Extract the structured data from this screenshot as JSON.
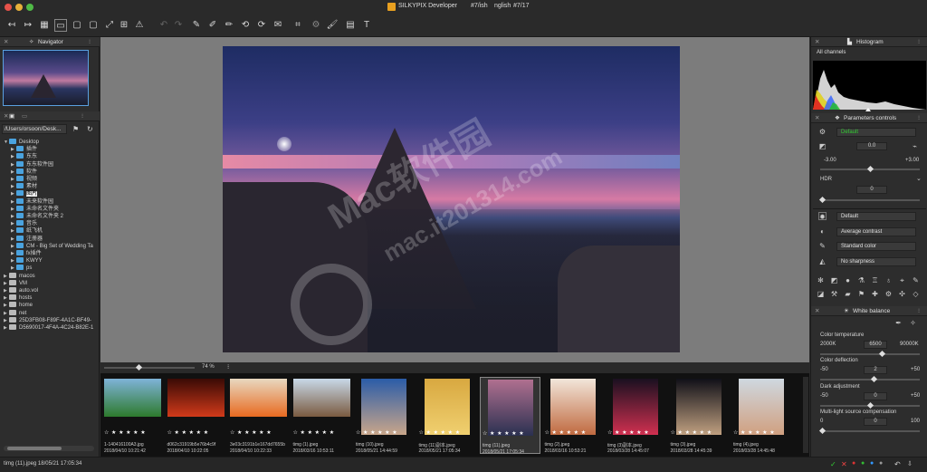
{
  "window": {
    "title": "SILKYPIX Developer",
    "subtitle_1": "#7/ish",
    "subtitle_2": "nglish",
    "subtitle_3": "#7/17"
  },
  "navigator": {
    "title": "Navigator"
  },
  "folders": {
    "path": "/Users/orsoon/Desk...",
    "items": [
      {
        "label": "Desktop",
        "level": 0,
        "expanded": true
      },
      {
        "label": "插件",
        "level": 1
      },
      {
        "label": "东东",
        "level": 1
      },
      {
        "label": "东东软件园",
        "level": 1
      },
      {
        "label": "软件",
        "level": 1
      },
      {
        "label": "视频",
        "level": 1
      },
      {
        "label": "素材",
        "level": 1
      },
      {
        "label": "图片",
        "level": 1,
        "selected": true
      },
      {
        "label": "未来软件园",
        "level": 1
      },
      {
        "label": "未命名文件夹",
        "level": 1
      },
      {
        "label": "未命名文件夹 2",
        "level": 1
      },
      {
        "label": "音乐",
        "level": 1
      },
      {
        "label": "纸飞机",
        "level": 1
      },
      {
        "label": "注册器",
        "level": 1
      },
      {
        "label": "CM - Big Set of Wedding Ta",
        "level": 1
      },
      {
        "label": "fx插件",
        "level": 1
      },
      {
        "label": "KWYY",
        "level": 1
      },
      {
        "label": "ps",
        "level": 1
      },
      {
        "label": "macos",
        "level": 0
      },
      {
        "label": "VM",
        "level": 0
      },
      {
        "label": "auto.vol",
        "level": 0
      },
      {
        "label": "hosts",
        "level": 0
      },
      {
        "label": "home",
        "level": 0
      },
      {
        "label": "net",
        "level": 0
      },
      {
        "label": "25D3FB08-F89F-4A1C-BF49-",
        "level": 0
      },
      {
        "label": "D5690017-4F4A-4C24-B82E-1",
        "level": 0
      }
    ]
  },
  "viewer": {
    "zoom": "74 %"
  },
  "filmstrip": [
    {
      "file": "1-140416100A3.jpg",
      "date": "2018/04/10 10:21:42",
      "colors": [
        "#7fb3d8",
        "#2d7a2d"
      ]
    },
    {
      "file": "d062c31919b5e76b4c9f",
      "date": "2018/04/10 10:22:05",
      "colors": [
        "#3a0a05",
        "#d13a1a"
      ]
    },
    {
      "file": "3e03c3191b1e167dd7655b",
      "date": "2018/04/10 10:22:33",
      "colors": [
        "#e8d8c0",
        "#e86a20"
      ]
    },
    {
      "file": "timg (1).jpeg",
      "date": "2018/03/16 10:53:11",
      "colors": [
        "#c8d8e8",
        "#7a5a40"
      ]
    },
    {
      "file": "timg (10).jpeg",
      "date": "2018/05/21 14:44:59",
      "colors": [
        "#2b5ca8",
        "#c9a68a"
      ]
    },
    {
      "file": "timg (11)副本.jpeg",
      "date": "2018/05/21 17:05:34",
      "colors": [
        "#d8a840",
        "#f0d070"
      ]
    },
    {
      "file": "timg (11).jpeg",
      "date": "2018/05/21 17:05:34",
      "colors": [
        "#b07090",
        "#2a3050"
      ]
    },
    {
      "file": "timg (2).jpeg",
      "date": "2018/03/16 10:53:21",
      "colors": [
        "#f2e6da",
        "#c06a40"
      ]
    },
    {
      "file": "timg (3)副本.jpeg",
      "date": "2018/03/28 14:45:07",
      "colors": [
        "#1a1020",
        "#d03050"
      ]
    },
    {
      "file": "timg (3).jpeg",
      "date": "2018/03/28 14:45:39",
      "colors": [
        "#101018",
        "#c0a080"
      ]
    },
    {
      "file": "timg (4).jpeg",
      "date": "2018/03/28 14:45:48",
      "colors": [
        "#cfd8e0",
        "#d0a080"
      ]
    }
  ],
  "status": {
    "text": "timg (11).jpeg 18/05/21 17:05:34"
  },
  "histogram": {
    "title": "Histogram",
    "channel": "All channels"
  },
  "params": {
    "title": "Parameters controls",
    "preset": "Default",
    "exposure_value": "0.0",
    "exposure_min": "-3.00",
    "exposure_max": "+3.00",
    "hdr_label": "HDR",
    "hdr_value": "0",
    "tone_preset": "Default",
    "contrast": "Average contrast",
    "color": "Standard color",
    "sharpness": "No sharpness"
  },
  "white_balance": {
    "title": "White balance",
    "color_temp_label": "Color temperature",
    "color_temp_min": "2000K",
    "color_temp_value": "6500",
    "color_temp_max": "90000K",
    "color_deflection_label": "Color deflection",
    "deflection_min": "-50",
    "deflection_value": "2",
    "deflection_max": "+50",
    "dark_adj_label": "Dark adjustment",
    "dark_min": "-50",
    "dark_value": "0",
    "dark_max": "+50",
    "multi_label": "Multi-light source compensation",
    "multi_min": "0",
    "multi_value": "0",
    "multi_max": "100"
  },
  "watermark": {
    "line1": "Mac软件园",
    "line2": "mac.it201314.com"
  }
}
